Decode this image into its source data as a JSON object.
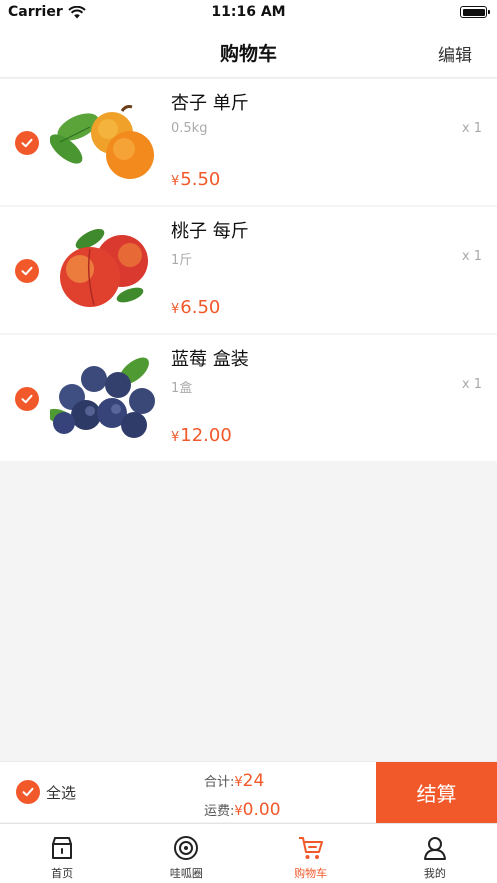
{
  "status_bar": {
    "carrier": "Carrier",
    "time": "11:16 AM"
  },
  "nav": {
    "title": "购物车",
    "edit_label": "编辑"
  },
  "cart": {
    "items": [
      {
        "name": "杏子 单斤",
        "spec": "0.5kg",
        "qty": "x 1",
        "currency": "¥",
        "price": "5.50",
        "checked": true,
        "image": "apricot-image"
      },
      {
        "name": "桃子 每斤",
        "spec": "1斤",
        "qty": "x 1",
        "currency": "¥",
        "price": "6.50",
        "checked": true,
        "image": "peach-image"
      },
      {
        "name": "蓝莓 盒装",
        "spec": "1盒",
        "qty": "x 1",
        "currency": "¥",
        "price": "12.00",
        "checked": true,
        "image": "blueberry-image"
      }
    ]
  },
  "checkout": {
    "select_all_label": "全选",
    "total_label": "合计:",
    "total_currency": "¥",
    "total_value": "24",
    "shipping_label": "运费:",
    "shipping_currency": "¥",
    "shipping_value": "0.00",
    "button_label": "结算"
  },
  "tabs": [
    {
      "label": "首页",
      "icon": "home-icon",
      "active": false
    },
    {
      "label": "哇呱圈",
      "icon": "circle-icon",
      "active": false
    },
    {
      "label": "购物车",
      "icon": "cart-icon",
      "active": true
    },
    {
      "label": "我的",
      "icon": "profile-icon",
      "active": false
    }
  ],
  "colors": {
    "accent": "#f1592a",
    "background": "#f4f4f4"
  }
}
